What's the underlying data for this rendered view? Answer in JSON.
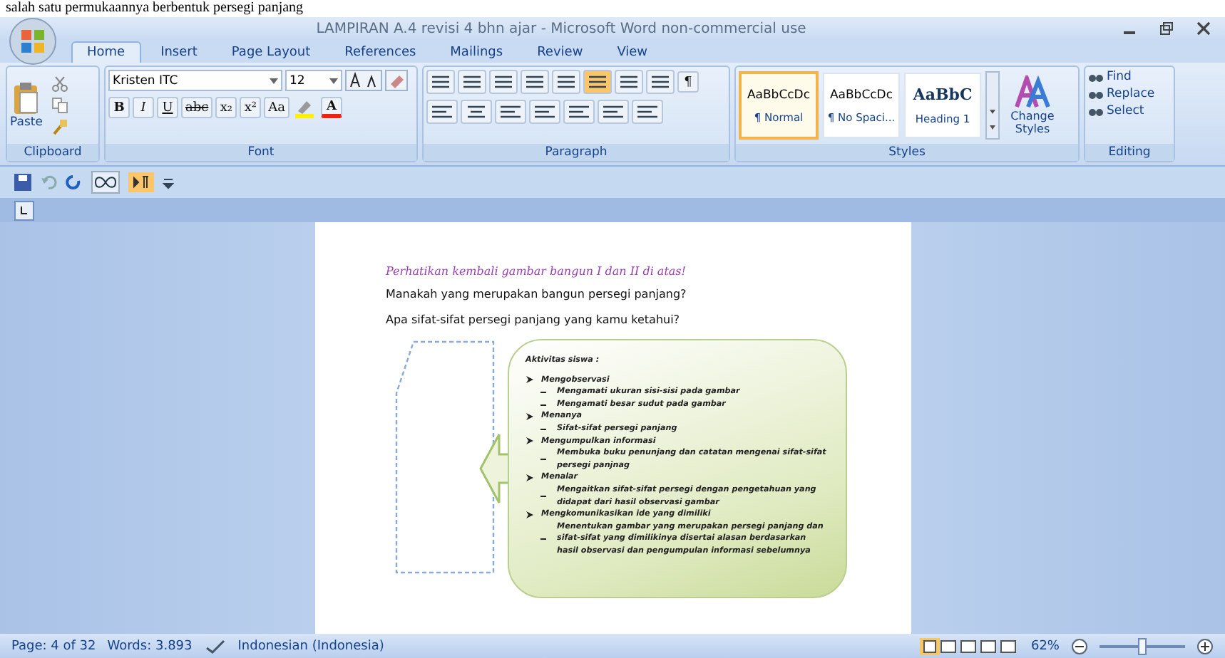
{
  "cut_text": "salah satu permukaannya berbentuk persegi panjang",
  "window": {
    "title": "LAMPIRAN A.4 revisi 4 bhn ajar - Microsoft Word non-commercial use"
  },
  "tabs": [
    {
      "label": "Home",
      "selected": true
    },
    {
      "label": "Insert",
      "selected": false
    },
    {
      "label": "Page Layout",
      "selected": false
    },
    {
      "label": "References",
      "selected": false
    },
    {
      "label": "Mailings",
      "selected": false
    },
    {
      "label": "Review",
      "selected": false
    },
    {
      "label": "View",
      "selected": false
    }
  ],
  "ribbon": {
    "clipboard": {
      "label": "Clipboard",
      "paste": "Paste"
    },
    "font": {
      "label": "Font",
      "font_name": "Kristen ITC",
      "font_size": "12",
      "buttons": [
        "B",
        "I",
        "U",
        "abc",
        "x₂",
        "x²",
        "Aa"
      ],
      "font_color": "A"
    },
    "paragraph": {
      "label": "Paragraph",
      "show_marks": "¶"
    },
    "styles": {
      "label": "Styles",
      "change_styles": "Change Styles",
      "gallery": [
        {
          "preview": "AaBbCcDc",
          "name": "¶ Normal",
          "selected": true
        },
        {
          "preview": "AaBbCcDc",
          "name": "¶ No Spaci...",
          "selected": false
        },
        {
          "preview": "AaBbC",
          "name": "Heading 1",
          "selected": false
        }
      ]
    },
    "editing": {
      "label": "Editing",
      "items": [
        "Find",
        "Replace",
        "Select"
      ]
    }
  },
  "document": {
    "heading": "Perhatikan kembali gambar bangun I dan II di atas!",
    "questions": [
      "Manakah yang merupakan bangun persegi panjang?",
      "Apa sifat-sifat persegi panjang yang kamu ketahui?"
    ],
    "callout": {
      "title": "Aktivitas siswa :",
      "items": [
        {
          "label": "Mengobservasi",
          "children": [
            "Mengamati ukuran sisi-sisi pada gambar",
            "Mengamati besar sudut pada gambar"
          ]
        },
        {
          "label": "Menanya",
          "children": [
            "Sifat-sifat persegi panjang"
          ]
        },
        {
          "label": "Mengumpulkan informasi",
          "children": [
            "Membuka buku penunjang dan catatan mengenai sifat-sifat persegi panjnag"
          ]
        },
        {
          "label": "Menalar",
          "children": [
            "Mengaitkan sifat-sifat persegi dengan pengetahuan yang didapat dari hasil observasi gambar"
          ]
        },
        {
          "label": "Mengkomunikasikan ide yang dimiliki",
          "children": [
            "Menentukan gambar yang merupakan persegi panjang dan sifat-sifat yang dimilikinya disertai alasan berdasarkan hasil observasi dan pengumpulan informasi sebelumnya"
          ]
        }
      ]
    }
  },
  "status_bar": {
    "page": "Page: 4 of 32",
    "words": "Words: 3.893",
    "language": "Indonesian (Indonesia)",
    "zoom": "62%",
    "zoom_slider": {
      "level": 0.5
    }
  }
}
